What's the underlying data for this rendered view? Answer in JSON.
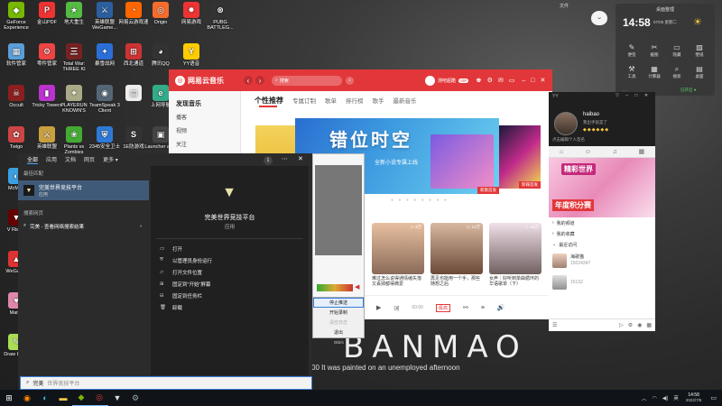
{
  "desktop": {
    "col1": [
      {
        "label": "GeForce Experience",
        "icon": "geforce-icon",
        "color": "#76b900",
        "glyph": "◆"
      },
      {
        "label": "软件管家",
        "icon": "grid-icon",
        "color": "#5a9fd8",
        "glyph": "▦"
      },
      {
        "label": "Occult",
        "icon": "occult-icon",
        "color": "#8b1e1e",
        "glyph": "☠"
      },
      {
        "label": "Twigo",
        "icon": "twigo-icon",
        "color": "#c44",
        "glyph": "✿"
      },
      {
        "label": "McMup",
        "icon": "mcmup-icon",
        "color": "#3ca0e0",
        "glyph": "◐"
      },
      {
        "label": "V Rising",
        "icon": "vrising-icon",
        "color": "#600",
        "glyph": "▼"
      },
      {
        "label": "WeGame",
        "icon": "wegame-icon",
        "color": "#d33",
        "glyph": "▲"
      },
      {
        "label": "Maiyo",
        "icon": "maiyo-icon",
        "color": "#d8a",
        "glyph": "♥"
      },
      {
        "label": "Draw Hung",
        "icon": "draw-icon",
        "color": "#ad5",
        "glyph": "✎"
      },
      {
        "label": "Tag",
        "icon": "tag-icon",
        "color": "#c33",
        "glyph": "◼"
      }
    ],
    "col2": [
      {
        "label": "金山PDF",
        "icon": "pdf-icon",
        "color": "#e33",
        "glyph": "P"
      },
      {
        "label": "零件管家",
        "icon": "parts-icon",
        "color": "#e44",
        "glyph": "⚙"
      },
      {
        "label": "Tricky Towers",
        "icon": "tricky-icon",
        "color": "#b3c",
        "glyph": "▮"
      },
      {
        "label": "英雄联盟",
        "icon": "lol-icon",
        "color": "#c8a040",
        "glyph": "⚔"
      },
      {
        "label": "",
        "icon": "blank-icon",
        "color": "#333",
        "glyph": ""
      }
    ],
    "col3": [
      {
        "label": "地大重生",
        "icon": "game-icon",
        "color": "#5b4",
        "glyph": "★"
      },
      {
        "label": "Total War: THREE KI",
        "icon": "totalwar-icon",
        "color": "#722",
        "glyph": "三"
      },
      {
        "label": "PLAYERUN KNOWN'S",
        "icon": "pubg-icon",
        "color": "#aa8",
        "glyph": "⌖"
      },
      {
        "label": "Plants vs Zombies",
        "icon": "pvz-icon",
        "color": "#4a3",
        "glyph": "❀"
      }
    ],
    "col4": [
      {
        "label": "英雄联盟 WeGame...",
        "icon": "lol2-icon",
        "color": "#2b5fa0",
        "glyph": "⚔"
      },
      {
        "label": "暴雪战网",
        "icon": "battlenet-icon",
        "color": "#2b6ed8",
        "glyph": "✦"
      },
      {
        "label": "TeamSpeak 3 Client",
        "icon": "teamspeak-icon",
        "color": "#567",
        "glyph": "◉"
      },
      {
        "label": "2345安全卫士",
        "icon": "shield-icon",
        "color": "#2e7ad8",
        "glyph": "⛨"
      }
    ],
    "col5": [
      {
        "label": "网易云游戏速",
        "icon": "netease-game-icon",
        "color": "#f60",
        "glyph": "◔"
      },
      {
        "label": "西北通道",
        "icon": "xb-icon",
        "color": "#c33",
        "glyph": "⊞"
      },
      {
        "label": "",
        "icon": "app-icon",
        "color": "#eee",
        "glyph": "▤"
      },
      {
        "label": "1E防游戏",
        "icon": "1e-icon",
        "color": "#333",
        "glyph": "S"
      }
    ],
    "col6": [
      {
        "label": "Origin",
        "icon": "origin-icon",
        "color": "#f56c2d",
        "glyph": "◎"
      },
      {
        "label": "腾讯QQ",
        "icon": "qq-icon",
        "color": "#333",
        "glyph": "◕"
      },
      {
        "label": "上网导航",
        "icon": "browser-icon",
        "color": "#3a8",
        "glyph": "e"
      },
      {
        "label": "Launcher ama",
        "icon": "launcher-icon",
        "color": "#444",
        "glyph": "▣"
      }
    ],
    "col7": [
      {
        "label": "网易游戏",
        "icon": "netease-icon",
        "color": "#e33",
        "glyph": "✸"
      },
      {
        "label": "YY语音",
        "icon": "yy-icon",
        "color": "#fc0",
        "glyph": "Y"
      }
    ],
    "col8": [
      {
        "label": "PUBG BATTLEG...",
        "icon": "pubg2-icon",
        "color": "#333",
        "glyph": "⊗"
      }
    ]
  },
  "widget": {
    "time": "14:58",
    "date": "07/05 星期二",
    "title": "桌面整理",
    "row1": [
      {
        "label": "便签",
        "glyph": "✎"
      },
      {
        "label": "截图",
        "glyph": "✂"
      },
      {
        "label": "隐藏",
        "glyph": "▭"
      },
      {
        "label": "壁纸",
        "glyph": "▨"
      }
    ],
    "row2": [
      {
        "label": "工具",
        "glyph": "⚒"
      },
      {
        "label": "计算器",
        "glyph": "▦"
      },
      {
        "label": "搜索",
        "glyph": "⌕"
      },
      {
        "label": "桌面",
        "glyph": "▤"
      }
    ],
    "footer_left": "...",
    "footer_right": "已开启 ●"
  },
  "start_menu": {
    "tabs": [
      "全部",
      "应用",
      "文档",
      "网页",
      "更多 ▾"
    ],
    "badge": "1",
    "best_match_header": "最佳匹配",
    "best_match_title": "完美世界竞技平台",
    "best_match_sub": "应用",
    "web_header": "搜索网页",
    "web_item": "完美 - 查看网络搜索结果",
    "app_title": "完美世界竞技平台",
    "app_sub": "应用",
    "actions": [
      {
        "icon": "open-icon",
        "glyph": "▭",
        "label": "打开"
      },
      {
        "icon": "admin-icon",
        "glyph": "⛨",
        "label": "以管理员身份运行"
      },
      {
        "icon": "folder-icon",
        "glyph": "▱",
        "label": "打开文件位置"
      },
      {
        "icon": "pin-start-icon",
        "glyph": "⊞",
        "label": "固定到\"开始\"屏幕"
      },
      {
        "icon": "pin-taskbar-icon",
        "glyph": "⊟",
        "label": "固定到任务栏"
      },
      {
        "icon": "uninstall-icon",
        "glyph": "🗑",
        "label": "卸载"
      }
    ]
  },
  "search": {
    "typed": "完美",
    "suggestion": "世界竞技平台"
  },
  "music": {
    "logo": "网易云音乐",
    "nav_back": "‹",
    "nav_fwd": "›",
    "search_placeholder": "搜索",
    "user": "测吧超酷",
    "vip": "VIP",
    "sidebar": [
      {
        "label": "发现音乐",
        "active": true
      },
      {
        "label": "播客",
        "active": false
      },
      {
        "label": "视频",
        "active": false
      },
      {
        "label": "关注",
        "active": false
      }
    ],
    "tabs": [
      "个性推荐",
      "专属订制",
      "歌单",
      "排行榜",
      "歌手",
      "最新音乐"
    ],
    "banner_title": "错位时空",
    "banner_sub": "全新小说专属上线",
    "banner_tag": "新歌首发",
    "side_banner_tag": "新碟首发",
    "cards": [
      {
        "title": "难过怎么说得通情绪失落又丢掉都得痛爱",
        "plays": "▷ 3万"
      },
      {
        "title": "再见也能用一个手，那些随想之后",
        "plays": "▷ 14万"
      },
      {
        "title": "女声｜好听到单曲循环的华语歌单（下）",
        "plays": "▷ 44万"
      }
    ],
    "player_time": "00:00",
    "player_label": "词"
  },
  "ctx_menu": {
    "items": [
      "停止推送",
      "开始录制",
      "清空日志",
      "退出"
    ],
    "overlay_value": "0kb/s"
  },
  "chat": {
    "app": "YY",
    "username": "haibao",
    "status": "我出手就是了",
    "intro": "点击编辑个人签名",
    "tabs": [
      "⌂",
      "☺",
      "♫",
      "▦"
    ],
    "ad_title": "精彩世界",
    "ad_sub": "年度积分赛",
    "list_headers": [
      "我的频道",
      "我的收藏",
      "最近访问"
    ],
    "contacts": [
      {
        "name": "海歌猫",
        "id": "15024347"
      },
      {
        "name": "",
        "id": "15132"
      }
    ]
  },
  "taskbar": {
    "time": "14:58",
    "date": "2022/7/5",
    "lang": "英",
    "apps": [
      {
        "icon": "windows-icon",
        "glyph": "⊞",
        "color": "#ffffff"
      },
      {
        "icon": "firefox-icon",
        "glyph": "◉",
        "color": "#ff8a00"
      },
      {
        "icon": "edge-icon",
        "glyph": "◐",
        "color": "#31c0ea"
      },
      {
        "icon": "explorer-icon",
        "glyph": "▬",
        "color": "#f7c948"
      },
      {
        "icon": "nvidia-icon",
        "glyph": "◆",
        "color": "#76b900"
      },
      {
        "icon": "netease-music-icon",
        "glyph": "◎",
        "color": "#e2373a"
      },
      {
        "icon": "perfect-world-icon",
        "glyph": "▼",
        "color": "#ddd"
      },
      {
        "icon": "steam-icon",
        "glyph": "⚙",
        "color": "#9aa"
      }
    ]
  },
  "wallpaper": {
    "big_text": "BANMAO",
    "tagline": "00 It was painted on an unemployed afternoon",
    "top_label": "文件"
  }
}
